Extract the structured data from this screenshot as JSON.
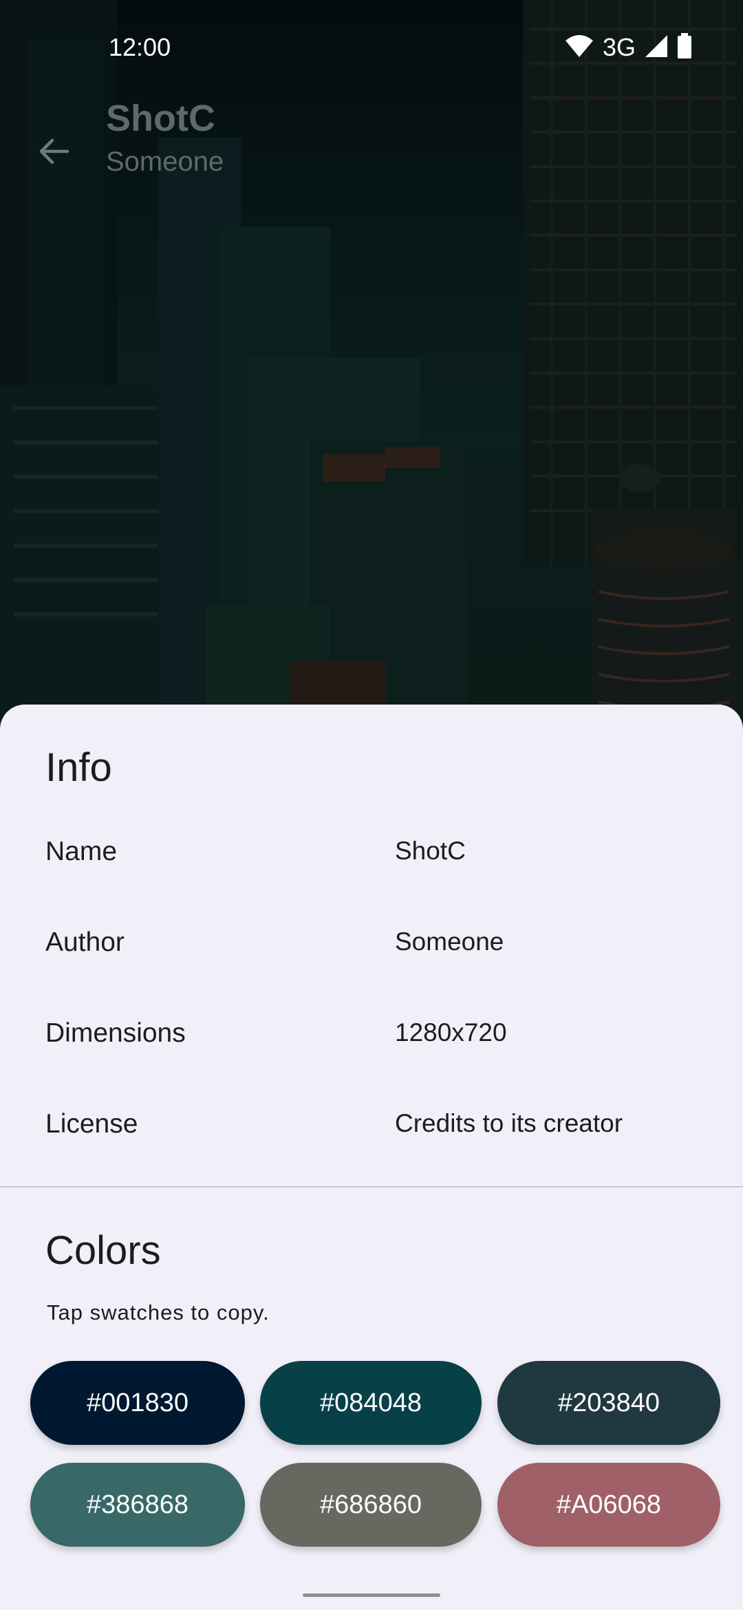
{
  "status_bar": {
    "time": "12:00",
    "network": "3G",
    "icons": [
      "wifi-icon",
      "cellular-signal-icon",
      "battery-icon"
    ]
  },
  "app_bar": {
    "back_icon": "arrow-back-icon",
    "title": "ShotC",
    "subtitle": "Someone"
  },
  "info": {
    "title": "Info",
    "rows": [
      {
        "label": "Name",
        "value": "ShotC"
      },
      {
        "label": "Author",
        "value": "Someone"
      },
      {
        "label": "Dimensions",
        "value": "1280x720"
      },
      {
        "label": "License",
        "value": "Credits to its creator"
      }
    ]
  },
  "colors": {
    "title": "Colors",
    "hint": "Tap swatches to copy.",
    "swatches": [
      {
        "label": "#001830",
        "color": "#001830"
      },
      {
        "label": "#084048",
        "color": "#084048"
      },
      {
        "label": "#203840",
        "color": "#203840"
      },
      {
        "label": "#386868",
        "color": "#386868"
      },
      {
        "label": "#686860",
        "color": "#686860"
      },
      {
        "label": "#A06068",
        "color": "#A06068"
      }
    ]
  }
}
